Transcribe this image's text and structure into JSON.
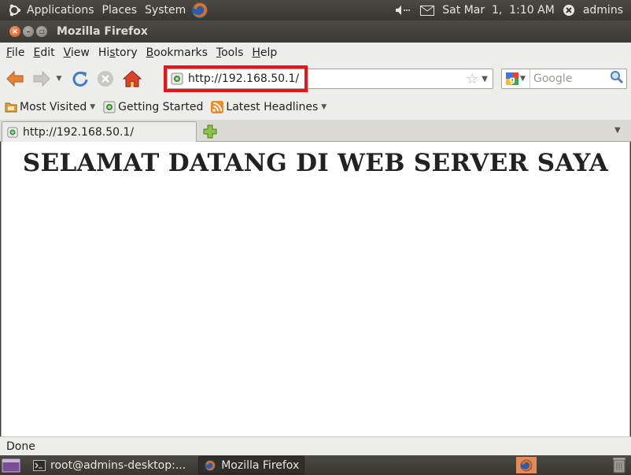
{
  "top_panel": {
    "menus": [
      "Applications",
      "Places",
      "System"
    ],
    "clock": "Sat Mar  1,  1:10 AM",
    "user": "admins"
  },
  "window": {
    "title": "Mozilla Firefox"
  },
  "menubar": {
    "items": [
      {
        "label": "File",
        "accel": "F",
        "rest": "ile"
      },
      {
        "label": "Edit",
        "accel": "E",
        "rest": "dit"
      },
      {
        "label": "View",
        "accel": "V",
        "rest": "iew"
      },
      {
        "label": "History",
        "pre": "Hi",
        "accel": "s",
        "rest": "tory"
      },
      {
        "label": "Bookmarks",
        "accel": "B",
        "rest": "ookmarks"
      },
      {
        "label": "Tools",
        "accel": "T",
        "rest": "ools"
      },
      {
        "label": "Help",
        "accel": "H",
        "rest": "elp"
      }
    ]
  },
  "navbar": {
    "url": "http://192.168.50.1/",
    "search_placeholder": "Google",
    "highlight_color": "#e8141b"
  },
  "bookmarks": {
    "items": [
      "Most Visited",
      "Getting Started",
      "Latest Headlines"
    ]
  },
  "tabs": [
    {
      "label": "http://192.168.50.1/",
      "active": true
    }
  ],
  "page": {
    "heading": "SELAMAT DATANG DI WEB SERVER SAYA"
  },
  "status": {
    "text": "Done"
  },
  "taskbar": {
    "items": [
      {
        "label": "root@admins-desktop:...",
        "icon": "terminal-icon",
        "active": false
      },
      {
        "label": "Mozilla Firefox",
        "icon": "firefox-icon",
        "active": true
      }
    ]
  }
}
